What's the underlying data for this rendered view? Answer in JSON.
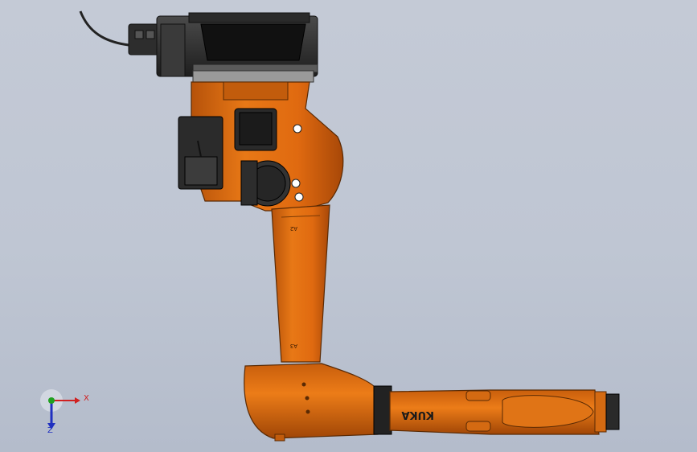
{
  "viewport": {
    "background_top": "#c4cad6",
    "background_bottom": "#b4bccb"
  },
  "model": {
    "brand_text": "KUKA",
    "axis_markings": [
      "A1",
      "A2",
      "A3"
    ],
    "colors": {
      "robot_orange": "#e06a10",
      "robot_orange_dark": "#a94a08",
      "motor_dark": "#2a2a2a",
      "base_gray": "#3a3a3a"
    }
  },
  "triad": {
    "x_label": "X",
    "y_label": "Y",
    "z_label": "Z",
    "colors": {
      "x": "#d02020",
      "y": "#20a020",
      "z": "#2030c0"
    }
  }
}
